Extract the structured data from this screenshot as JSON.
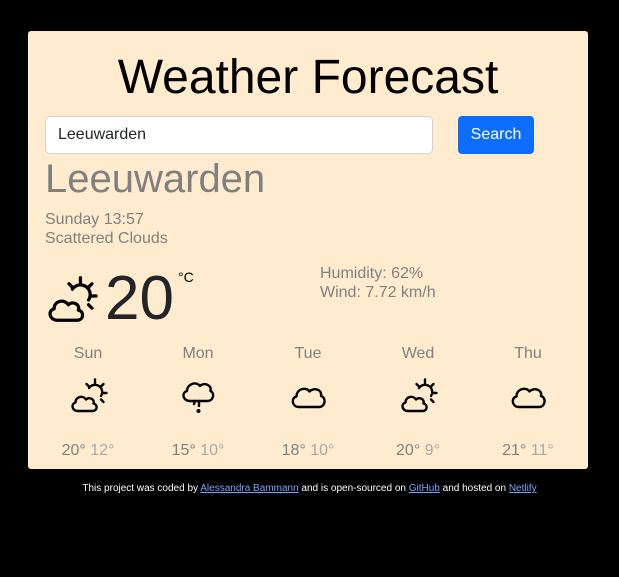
{
  "header": {
    "title": "Weather Forecast"
  },
  "search": {
    "value": "Leeuwarden",
    "button_label": "Search"
  },
  "current": {
    "city": "Leeuwarden",
    "datetime": "Sunday 13:57",
    "description": "Scattered Clouds",
    "temperature": "20",
    "unit": "°C",
    "humidity": "Humidity: 62%",
    "wind": "Wind: 7.72 km/h",
    "icon": "sun-behind-cloud-icon"
  },
  "forecast": [
    {
      "day": "Sun",
      "max": "20°",
      "min": "12°",
      "icon": "sun-behind-cloud-icon"
    },
    {
      "day": "Mon",
      "max": "15°",
      "min": "10°",
      "icon": "rain-cloud-icon"
    },
    {
      "day": "Tue",
      "max": "18°",
      "min": "10°",
      "icon": "cloud-icon"
    },
    {
      "day": "Wed",
      "max": "20°",
      "min": "9°",
      "icon": "sun-behind-cloud-icon"
    },
    {
      "day": "Thu",
      "max": "21°",
      "min": "11°",
      "icon": "cloud-icon"
    }
  ],
  "footer": {
    "prefix": "This project was coded by",
    "author_link": "Alessandra Bammann",
    "middle": "and is open-sourced on",
    "github_link": "GitHub",
    "hosted": "and hosted on",
    "netlify_link": "Netlify"
  },
  "colors": {
    "page_background": "#000000",
    "card_background": "#ffebcd",
    "accent": "#0d6efd",
    "muted_text": "#808080",
    "link": "#6ea8fe"
  }
}
